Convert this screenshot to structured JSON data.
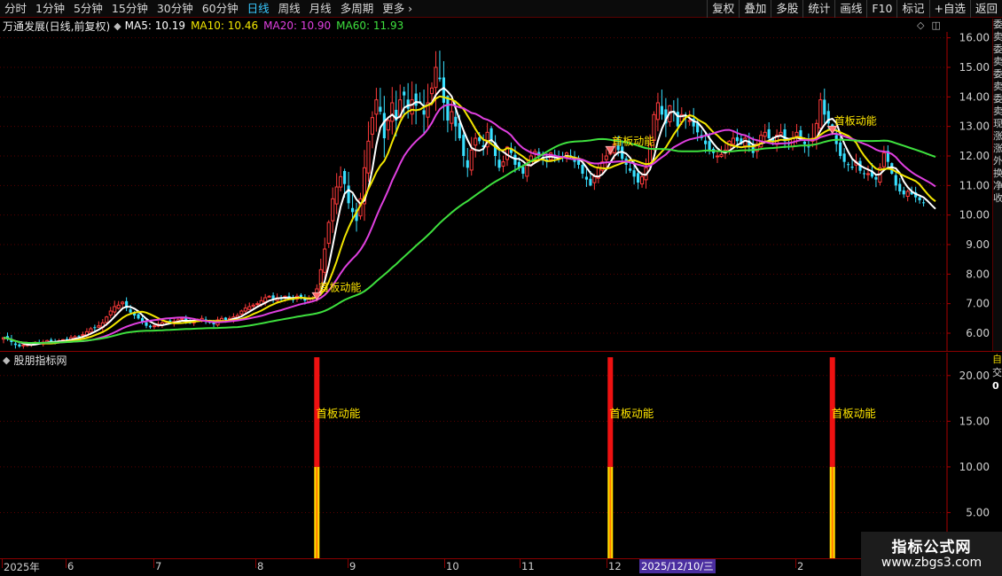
{
  "toolbar": {
    "periods": [
      "分时",
      "1分钟",
      "5分钟",
      "15分钟",
      "30分钟",
      "60分钟",
      "日线",
      "周线",
      "月线",
      "多周期",
      "更多 ›"
    ],
    "active_period": "日线",
    "right": [
      "复权",
      "叠加",
      "多股",
      "统计",
      "画线",
      "F10",
      "标记",
      "+自选",
      "返回"
    ]
  },
  "info": {
    "stock_name": "万通发展(日线,前复权)",
    "ma": [
      {
        "label": "MA5: 10.19",
        "color": "#ffffff"
      },
      {
        "label": "MA10: 10.46",
        "color": "#f2e600"
      },
      {
        "label": "MA20: 10.90",
        "color": "#e040e0"
      },
      {
        "label": "MA60: 11.93",
        "color": "#3ee03e"
      }
    ]
  },
  "chart_controls": [
    "◇",
    "◫"
  ],
  "indicator": {
    "title": "股朋指标网",
    "signal_label": "首板动能",
    "axis_labels": [
      "20.00",
      "15.00",
      "10.00",
      "5.00"
    ]
  },
  "right_strip": {
    "chars": [
      "委",
      "卖",
      "委",
      "卖",
      "委",
      "卖",
      "委",
      "卖",
      "现",
      "涨",
      "涨",
      "外",
      "换",
      "净",
      "收"
    ],
    "lower": [
      "自",
      "交",
      "0"
    ]
  },
  "time_axis": {
    "labels": [
      "2025年",
      "6",
      "7",
      "8",
      "9",
      "10",
      "11",
      "12",
      "1",
      "2"
    ],
    "cursor_date": "2025/12/10/三"
  },
  "watermark": {
    "title": "指标公式网",
    "url": "www.zbgs3.com"
  },
  "chart_data": {
    "type": "candlestick",
    "price_axis": {
      "ticks": [
        "16.00",
        "15.00",
        "14.00",
        "13.00",
        "12.00",
        "11.00",
        "10.00",
        "9.00",
        "8.00",
        "7.00",
        "6.00"
      ],
      "ylim": [
        5.4,
        16.2
      ]
    },
    "signal_label": "首板动能",
    "signals_bar_index": [
      79,
      153,
      209
    ],
    "indicator_series": {
      "name": "首板动能",
      "ylim": [
        0,
        22.5
      ],
      "values_at_signals": [
        22,
        22,
        22
      ],
      "split_level": 10
    },
    "ma_series": [
      {
        "name": "MA5",
        "color": "#ffffff"
      },
      {
        "name": "MA10",
        "color": "#f2e600"
      },
      {
        "name": "MA20",
        "color": "#e040e0"
      },
      {
        "name": "MA60",
        "color": "#3ee03e"
      }
    ],
    "close": [
      5.85,
      5.8,
      5.7,
      5.6,
      5.55,
      5.6,
      5.62,
      5.65,
      5.68,
      5.66,
      5.7,
      5.75,
      5.72,
      5.7,
      5.74,
      5.78,
      5.8,
      5.85,
      5.88,
      5.9,
      5.95,
      6.05,
      6.15,
      6.2,
      6.25,
      6.35,
      6.55,
      6.75,
      6.9,
      6.95,
      7.05,
      6.85,
      6.7,
      6.6,
      6.5,
      6.4,
      6.25,
      6.2,
      6.25,
      6.3,
      6.35,
      6.4,
      6.35,
      6.4,
      6.45,
      6.5,
      6.4,
      6.35,
      6.4,
      6.45,
      6.5,
      6.4,
      6.35,
      6.3,
      6.45,
      6.5,
      6.45,
      6.5,
      6.55,
      6.6,
      6.75,
      6.85,
      6.9,
      6.95,
      7.0,
      7.1,
      7.2,
      7.25,
      7.15,
      7.2,
      7.15,
      7.25,
      7.2,
      7.15,
      7.25,
      7.2,
      7.1,
      7.15,
      7.2,
      7.5,
      8.15,
      8.85,
      9.75,
      10.55,
      10.95,
      11.3,
      11.05,
      10.4,
      10.1,
      9.8,
      10.55,
      11.6,
      12.5,
      13.3,
      13.9,
      13.5,
      12.6,
      13.2,
      13.8,
      13.2,
      13.9,
      14.05,
      13.6,
      13.9,
      13.7,
      13.8,
      13.4,
      13.8,
      14.3,
      15.0,
      14.6,
      13.8,
      13.2,
      13.5,
      13.0,
      12.6,
      12.0,
      11.6,
      12.2,
      12.6,
      12.5,
      12.3,
      12.8,
      12.5,
      12.0,
      11.6,
      11.8,
      12.3,
      12.1,
      11.7,
      11.6,
      11.4,
      11.7,
      12.0,
      12.15,
      12.0,
      11.85,
      11.8,
      12.1,
      12.0,
      11.9,
      11.95,
      12.1,
      11.95,
      11.8,
      11.7,
      11.4,
      11.2,
      11.0,
      11.3,
      11.6,
      11.8,
      12.0,
      12.2,
      12.4,
      12.2,
      11.9,
      11.7,
      11.5,
      11.3,
      11.1,
      11.3,
      11.6,
      12.4,
      13.4,
      13.8,
      13.4,
      13.1,
      13.7,
      13.5,
      13.0,
      13.4,
      13.3,
      13.2,
      13.0,
      12.8,
      12.6,
      12.4,
      12.2,
      12.1,
      12.0,
      12.05,
      12.2,
      12.5,
      12.6,
      12.5,
      12.4,
      12.6,
      12.3,
      12.1,
      12.4,
      12.7,
      12.8,
      12.6,
      12.5,
      12.7,
      12.8,
      12.5,
      12.4,
      12.6,
      12.8,
      12.6,
      12.4,
      12.3,
      12.6,
      13.1,
      13.9,
      13.4,
      13.1,
      12.8,
      12.4,
      12.0,
      11.8,
      11.7,
      11.6,
      11.8,
      11.5,
      11.4,
      11.4,
      11.3,
      11.2,
      11.6,
      12.1,
      11.8,
      11.4,
      11.0,
      10.8,
      10.7,
      10.8,
      10.7,
      10.6,
      10.5,
      10.4,
      10.2,
      10.0,
      9.95
    ],
    "volatility": [
      0.15,
      0.15,
      0.15,
      0.15,
      0.12,
      0.1,
      0.08,
      0.08,
      0.08,
      0.08,
      0.08,
      0.08,
      0.08,
      0.08,
      0.08,
      0.08,
      0.08,
      0.08,
      0.08,
      0.08,
      0.1,
      0.12,
      0.15,
      0.15,
      0.15,
      0.15,
      0.18,
      0.2,
      0.2,
      0.2,
      0.2,
      0.15,
      0.15,
      0.12,
      0.12,
      0.12,
      0.1,
      0.1,
      0.1,
      0.1,
      0.1,
      0.1,
      0.1,
      0.1,
      0.1,
      0.1,
      0.1,
      0.1,
      0.1,
      0.1,
      0.1,
      0.1,
      0.1,
      0.1,
      0.1,
      0.1,
      0.1,
      0.1,
      0.12,
      0.12,
      0.14,
      0.14,
      0.14,
      0.14,
      0.14,
      0.14,
      0.14,
      0.14,
      0.14,
      0.14,
      0.14,
      0.14,
      0.14,
      0.14,
      0.14,
      0.14,
      0.14,
      0.14,
      0.14,
      0.3,
      0.4,
      0.5,
      0.6,
      0.6,
      0.5,
      0.55,
      0.55,
      0.6,
      0.5,
      0.5,
      0.6,
      0.7,
      0.8,
      0.8,
      0.8,
      0.7,
      0.8,
      0.8,
      0.8,
      0.7,
      0.9,
      0.9,
      0.7,
      0.7,
      0.8,
      0.8,
      0.8,
      0.8,
      0.9,
      1.0,
      1.0,
      0.8,
      0.7,
      0.6,
      0.6,
      0.5,
      0.5,
      0.5,
      0.5,
      0.5,
      0.4,
      0.4,
      0.4,
      0.4,
      0.4,
      0.4,
      0.3,
      0.3,
      0.3,
      0.3,
      0.3,
      0.25,
      0.25,
      0.25,
      0.25,
      0.25,
      0.25,
      0.25,
      0.25,
      0.25,
      0.25,
      0.25,
      0.25,
      0.25,
      0.25,
      0.25,
      0.3,
      0.3,
      0.3,
      0.3,
      0.3,
      0.3,
      0.3,
      0.3,
      0.3,
      0.35,
      0.35,
      0.35,
      0.35,
      0.35,
      0.35,
      0.35,
      0.35,
      0.4,
      0.5,
      0.6,
      0.6,
      0.55,
      0.55,
      0.5,
      0.5,
      0.45,
      0.45,
      0.4,
      0.4,
      0.4,
      0.4,
      0.35,
      0.35,
      0.3,
      0.3,
      0.3,
      0.3,
      0.3,
      0.3,
      0.3,
      0.3,
      0.3,
      0.3,
      0.3,
      0.3,
      0.3,
      0.3,
      0.3,
      0.3,
      0.3,
      0.3,
      0.3,
      0.3,
      0.3,
      0.3,
      0.3,
      0.4,
      0.5,
      0.6,
      0.5,
      0.45,
      0.4,
      0.35,
      0.3,
      0.3,
      0.3,
      0.3,
      0.3,
      0.3,
      0.3,
      0.25,
      0.25,
      0.3,
      0.3,
      0.3,
      0.25,
      0.25,
      0.25,
      0.2,
      0.2,
      0.2,
      0.2,
      0.2,
      0.2,
      0.2,
      0.2,
      0.2
    ]
  }
}
